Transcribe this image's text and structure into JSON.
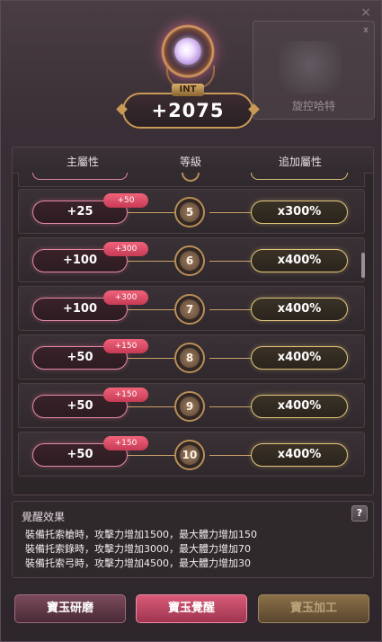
{
  "window": {
    "close_glyph": "×"
  },
  "ghost_card": {
    "header": "x",
    "name": "旋控哈特"
  },
  "stat": {
    "tag": "INT",
    "value": "+2075"
  },
  "table": {
    "columns": [
      "主屬性",
      "等級",
      "追加屬性"
    ],
    "rows": [
      {
        "main": "+25",
        "bonus": "+50",
        "level": "5",
        "extra": "x300%"
      },
      {
        "main": "+100",
        "bonus": "+300",
        "level": "6",
        "extra": "x400%"
      },
      {
        "main": "+100",
        "bonus": "+300",
        "level": "7",
        "extra": "x400%"
      },
      {
        "main": "+50",
        "bonus": "+150",
        "level": "8",
        "extra": "x400%"
      },
      {
        "main": "+50",
        "bonus": "+150",
        "level": "9",
        "extra": "x400%"
      },
      {
        "main": "+50",
        "bonus": "+150",
        "level": "10",
        "extra": "x400%"
      }
    ]
  },
  "effect": {
    "title": "覺醒效果",
    "help": "?",
    "lines": [
      "裝備托索槍時，攻擊力增加1500，最大體力增加150",
      "裝備托索錄時，攻擊力增加3000，最大體力增加70",
      "裝備托索弓時，攻擊力增加4500，最大體力增加30"
    ]
  },
  "buttons": {
    "polish": "寶玉研磨",
    "awaken": "寶玉覺醒",
    "process": "寶玉加工"
  },
  "colors": {
    "accent_pink": "#e05c79",
    "accent_gold": "#c89a56"
  }
}
